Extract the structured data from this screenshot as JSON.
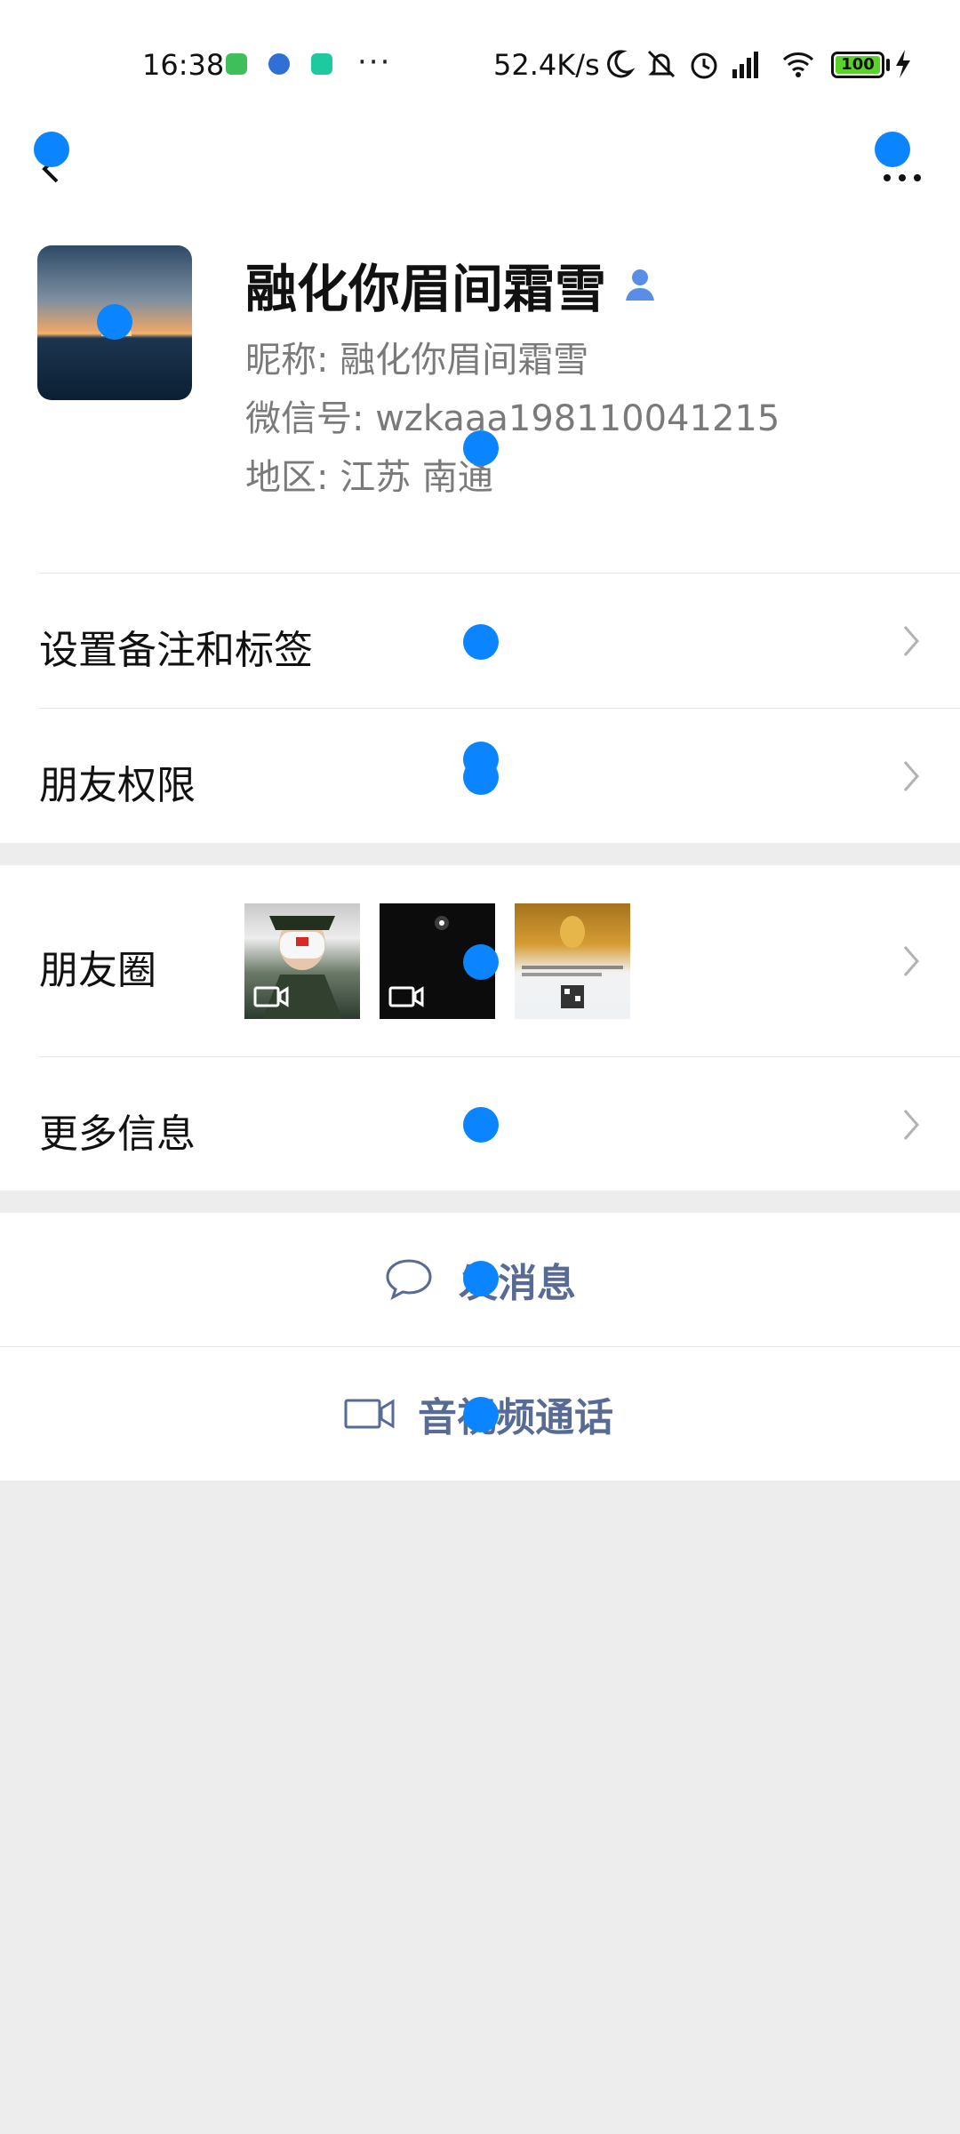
{
  "status_bar": {
    "time": "16:38",
    "more": "···",
    "network_speed": "52.4K/s",
    "battery": "100",
    "icons": [
      "app-green-icon",
      "app-blue-icon",
      "app-teal-icon",
      "moon-icon",
      "bell-off-icon",
      "alarm-icon",
      "signal-icon",
      "wifi-icon",
      "battery-icon",
      "charging-icon"
    ]
  },
  "nav": {
    "back_icon": "back-icon",
    "more_icon": "more-icon"
  },
  "profile": {
    "name": "融化你眉间霜雪",
    "nickname_label": "昵称:",
    "nickname": "融化你眉间霜雪",
    "wechat_id_label": "微信号:",
    "wechat_id": "wzkaaa198110041215",
    "region_label": "地区:",
    "region": "江苏 南通"
  },
  "menu": {
    "remark_tags": "设置备注和标签",
    "friend_permissions": "朋友权限",
    "moments": "朋友圈",
    "more_info": "更多信息"
  },
  "actions": {
    "send_message": "发消息",
    "av_call": "音视频通话"
  },
  "colors": {
    "accent_link": "#576b95",
    "background": "#ededed",
    "marker": "#0a84ff"
  }
}
